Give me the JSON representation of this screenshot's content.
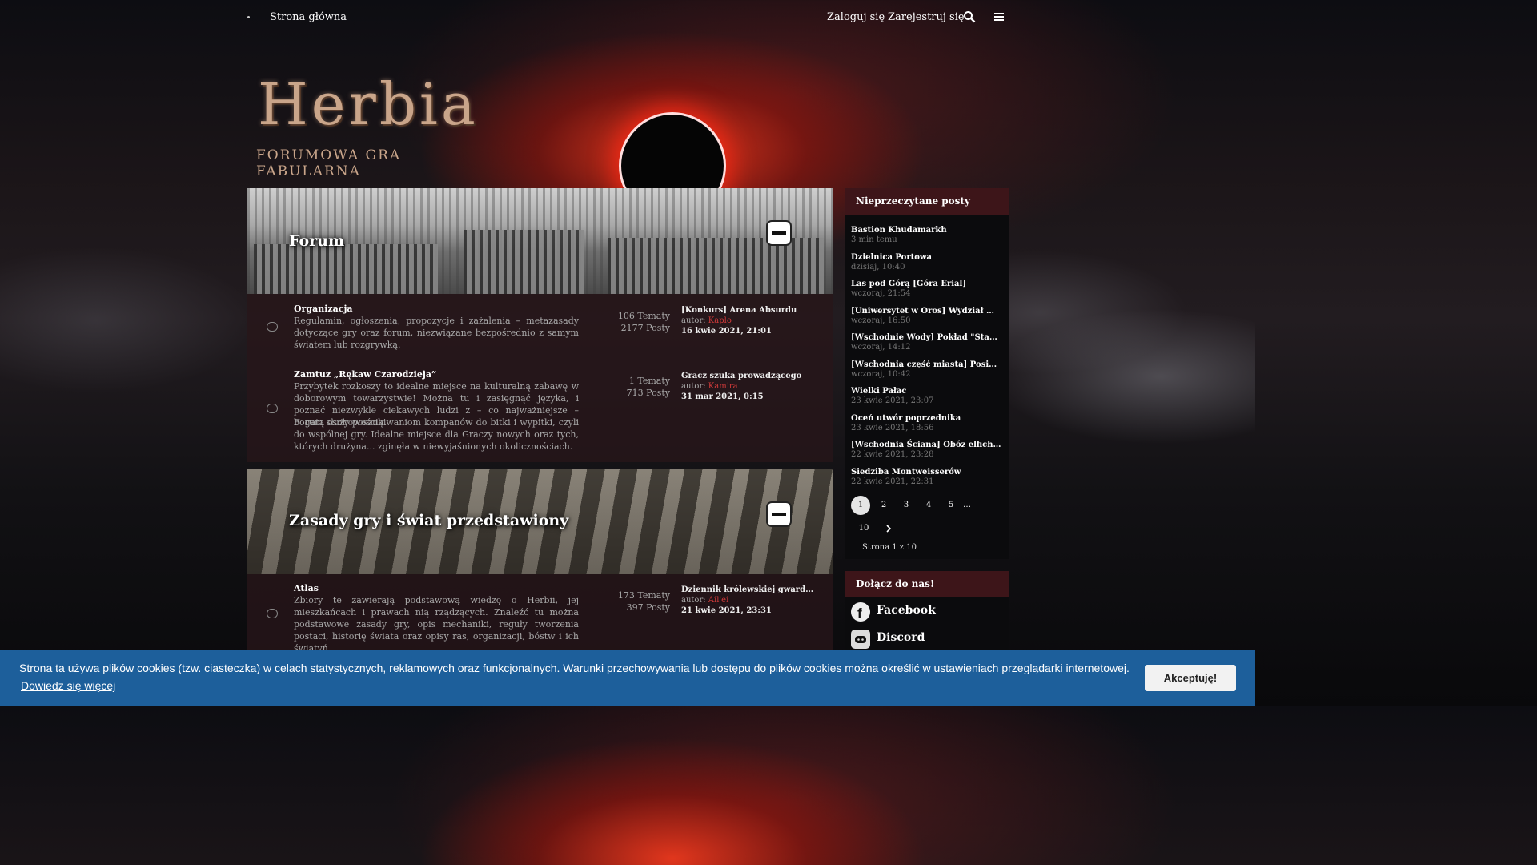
{
  "nav": {
    "home": "Strona główna",
    "login": "Zaloguj się",
    "register": "Zarejestruj się",
    "search_icon": "search-icon",
    "menu_icon": "hamburger-menu-icon"
  },
  "logo": {
    "title": "Herbia",
    "subtitle": "FORUMOWA GRA FABULARNA"
  },
  "categories": [
    {
      "title": "Forum",
      "forums": [
        {
          "name": "Organizacja",
          "description": "Regulamin, ogłoszenia, propozycje i zażalenia – metazasady dotyczące gry oraz forum, niezwiązane bezpośrednio z samym światem lub rozgrywką.",
          "topics": "106 Tematy",
          "posts": "2177 Posty",
          "last_title": "[Konkurs] Arena Absurdu",
          "last_author_prefix": "autor:",
          "last_author": "Kaplo",
          "last_date": "16 kwie 2021, 21:01"
        },
        {
          "name": "Zamtuz „Rękaw Czarodzieja”",
          "description": "Przybytek rozkoszy to idealne miejsce na kulturalną zabawę w doborowym towarzystwie! Można tu i zasięgnąć języka, i poznać niezwykle ciekawych ludzi z – co najważniejsze – bogatą osobowością.",
          "description2": "Forum służy poszukiwaniom kompanów do bitki i wypitki, czyli do wspólnej gry. Idealne miejsce dla Graczy nowych oraz tych, których drużyna... zginęła w niewyjaśnionych okolicznościach.",
          "topics": "1 Tematy",
          "posts": "713 Posty",
          "last_title": "Gracz szuka prowadzącego",
          "last_author_prefix": "autor:",
          "last_author": "Kamira",
          "last_date": "31 mar 2021, 0:15"
        }
      ]
    },
    {
      "title": "Zasady gry i świat przedstawiony",
      "forums": [
        {
          "name": "Atlas",
          "description": "Zbiory te zawierają podstawową wiedzę o Herbii, jej mieszkańcach i prawach nią rządzących. Znaleźć tu można podstawowe zasady gry, opis mechaniki, reguły tworzenia postaci, historię świata oraz opisy ras, organizacji, bóstw i ich świątyń.",
          "topics": "173 Tematy",
          "posts": "397 Posty",
          "last_title": "Dziennik królewskiej gwardzis...",
          "last_author_prefix": "autor:",
          "last_author": "Ail'ei",
          "last_date": "21 kwie 2021, 23:31"
        }
      ]
    }
  ],
  "sidebar": {
    "unread_title": "Nieprzeczytane posty",
    "unread": [
      {
        "title": "Bastion Khudamarkh",
        "time": "3 min temu"
      },
      {
        "title": "Dzielnica Portowa",
        "time": "dzisiaj, 10:40"
      },
      {
        "title": "Las pod Górą [Góra Erial]",
        "time": "wczoraj, 21:54"
      },
      {
        "title": "[Uniwersytet w Oros] Wydział Nauk Prz...",
        "time": "wczoraj, 16:50"
      },
      {
        "title": "[Wschodnie Wody] Pokład \"Starej Suki\"",
        "time": "wczoraj, 14:12"
      },
      {
        "title": "[Wschodnia część miasta] Posiadłość B...",
        "time": "wczoraj, 10:42"
      },
      {
        "title": "Wielki Pałac",
        "time": "23 kwie 2021, 23:07"
      },
      {
        "title": "Oceń utwór poprzednika",
        "time": "23 kwie 2021, 18:56"
      },
      {
        "title": "[Wschodnia Ściana] Obóz elfich uchodź...",
        "time": "22 kwie 2021, 23:28"
      },
      {
        "title": "Siedziba Montweisserów",
        "time": "22 kwie 2021, 22:31"
      }
    ],
    "pages": [
      "1",
      "2",
      "3",
      "4",
      "5",
      "…",
      "10"
    ],
    "next_icon": "chevron-right-icon",
    "page_info": "Strona 1 z 10",
    "join_title": "Dołącz do nas!",
    "social": [
      {
        "label": "Facebook",
        "icon": "facebook-icon"
      },
      {
        "label": "Discord",
        "icon": "discord-icon"
      }
    ]
  },
  "cookie": {
    "message": "Strona ta używa plików cookies (tzw. ciasteczka) w celach statystycznych, reklamowych oraz funkcjonalnych. Warunki przechowywania lub dostępu do plików cookies można określić w ustawieniach przeglądarki internetowej.",
    "more_link": "Dowiedz się więcej",
    "accept": "Akceptuję!"
  }
}
